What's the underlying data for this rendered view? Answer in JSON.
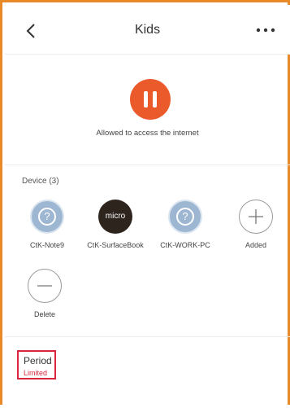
{
  "header": {
    "title": "Kids"
  },
  "status": {
    "text": "Allowed to access the internet"
  },
  "devices": {
    "title": "Device (3)",
    "items": [
      {
        "label": "CtK-Note9",
        "icon": "question-icon"
      },
      {
        "label": "CtK-SurfaceBook",
        "icon_text": "micro"
      },
      {
        "label": "CtK-WORK-PC",
        "icon": "question-icon"
      },
      {
        "label": "Added",
        "icon": "plus-icon"
      },
      {
        "label": "Delete",
        "icon": "minus-icon"
      }
    ]
  },
  "period": {
    "title": "Period",
    "subtitle": "Limited"
  },
  "colors": {
    "accent": "#EB5A2B",
    "highlight": "#D9263E",
    "frame": "#E8892A"
  }
}
